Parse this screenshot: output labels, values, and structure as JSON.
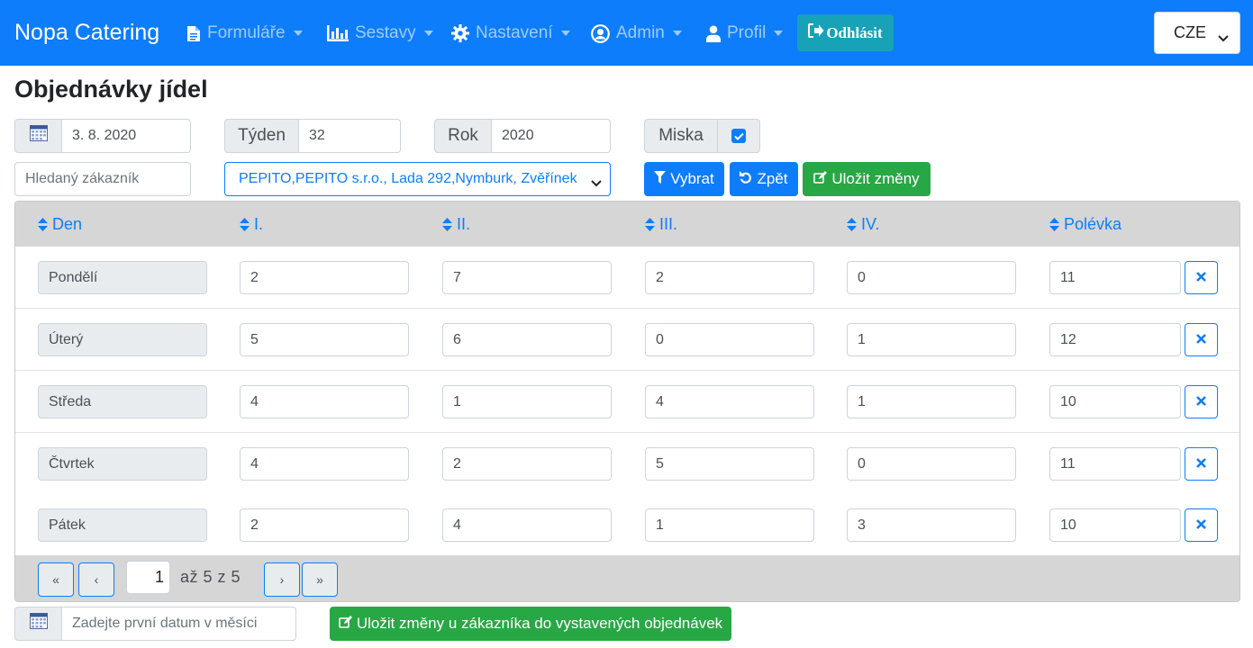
{
  "navbar": {
    "brand": "Nopa Catering",
    "items": [
      {
        "label": "Formuláře"
      },
      {
        "label": "Sestavy"
      },
      {
        "label": "Nastavení"
      },
      {
        "label": "Admin"
      },
      {
        "label": "Profil"
      }
    ],
    "logout_label": "Odhlásit",
    "language": "CZE"
  },
  "page_title": "Objednávky jídel",
  "filters": {
    "date_value": "3. 8. 2020",
    "week_label": "Týden",
    "week_value": "32",
    "year_label": "Rok",
    "year_value": "2020",
    "bowl_label": "Miska",
    "bowl_checked": true,
    "customer_search_placeholder": "Hledaný zákazník",
    "customer_selected": "PEPITO,PEPITO s.r.o., Lada 292,Nymburk, Zvěřínek",
    "select_button": "Vybrat",
    "back_button": "Zpět",
    "save_button": "Uložit změny"
  },
  "table": {
    "headers": [
      "Den",
      "I.",
      "II.",
      "III.",
      "IV.",
      "Polévka"
    ],
    "rows": [
      {
        "day": "Pondělí",
        "values": [
          "2",
          "7",
          "2",
          "0",
          "11"
        ]
      },
      {
        "day": "Úterý",
        "values": [
          "5",
          "6",
          "0",
          "1",
          "12"
        ]
      },
      {
        "day": "Středa",
        "values": [
          "4",
          "1",
          "4",
          "1",
          "10"
        ]
      },
      {
        "day": "Čtvrtek",
        "values": [
          "4",
          "2",
          "5",
          "0",
          "11"
        ]
      },
      {
        "day": "Pátek",
        "values": [
          "2",
          "4",
          "1",
          "3",
          "10"
        ]
      }
    ]
  },
  "pagination": {
    "first": "«",
    "prev": "‹",
    "current_page": "1",
    "range_text": "až 5 z 5",
    "next": "›",
    "last": "»"
  },
  "footer": {
    "date_placeholder": "Zadejte první datum v měsíci",
    "save_to_orders_button": "Uložit změny u zákazníka do vystavených objednávek"
  },
  "colors": {
    "primary": "#0d7dfc",
    "info": "#17a2b8",
    "success": "#28a745",
    "table_header": "#d6d6d6"
  }
}
